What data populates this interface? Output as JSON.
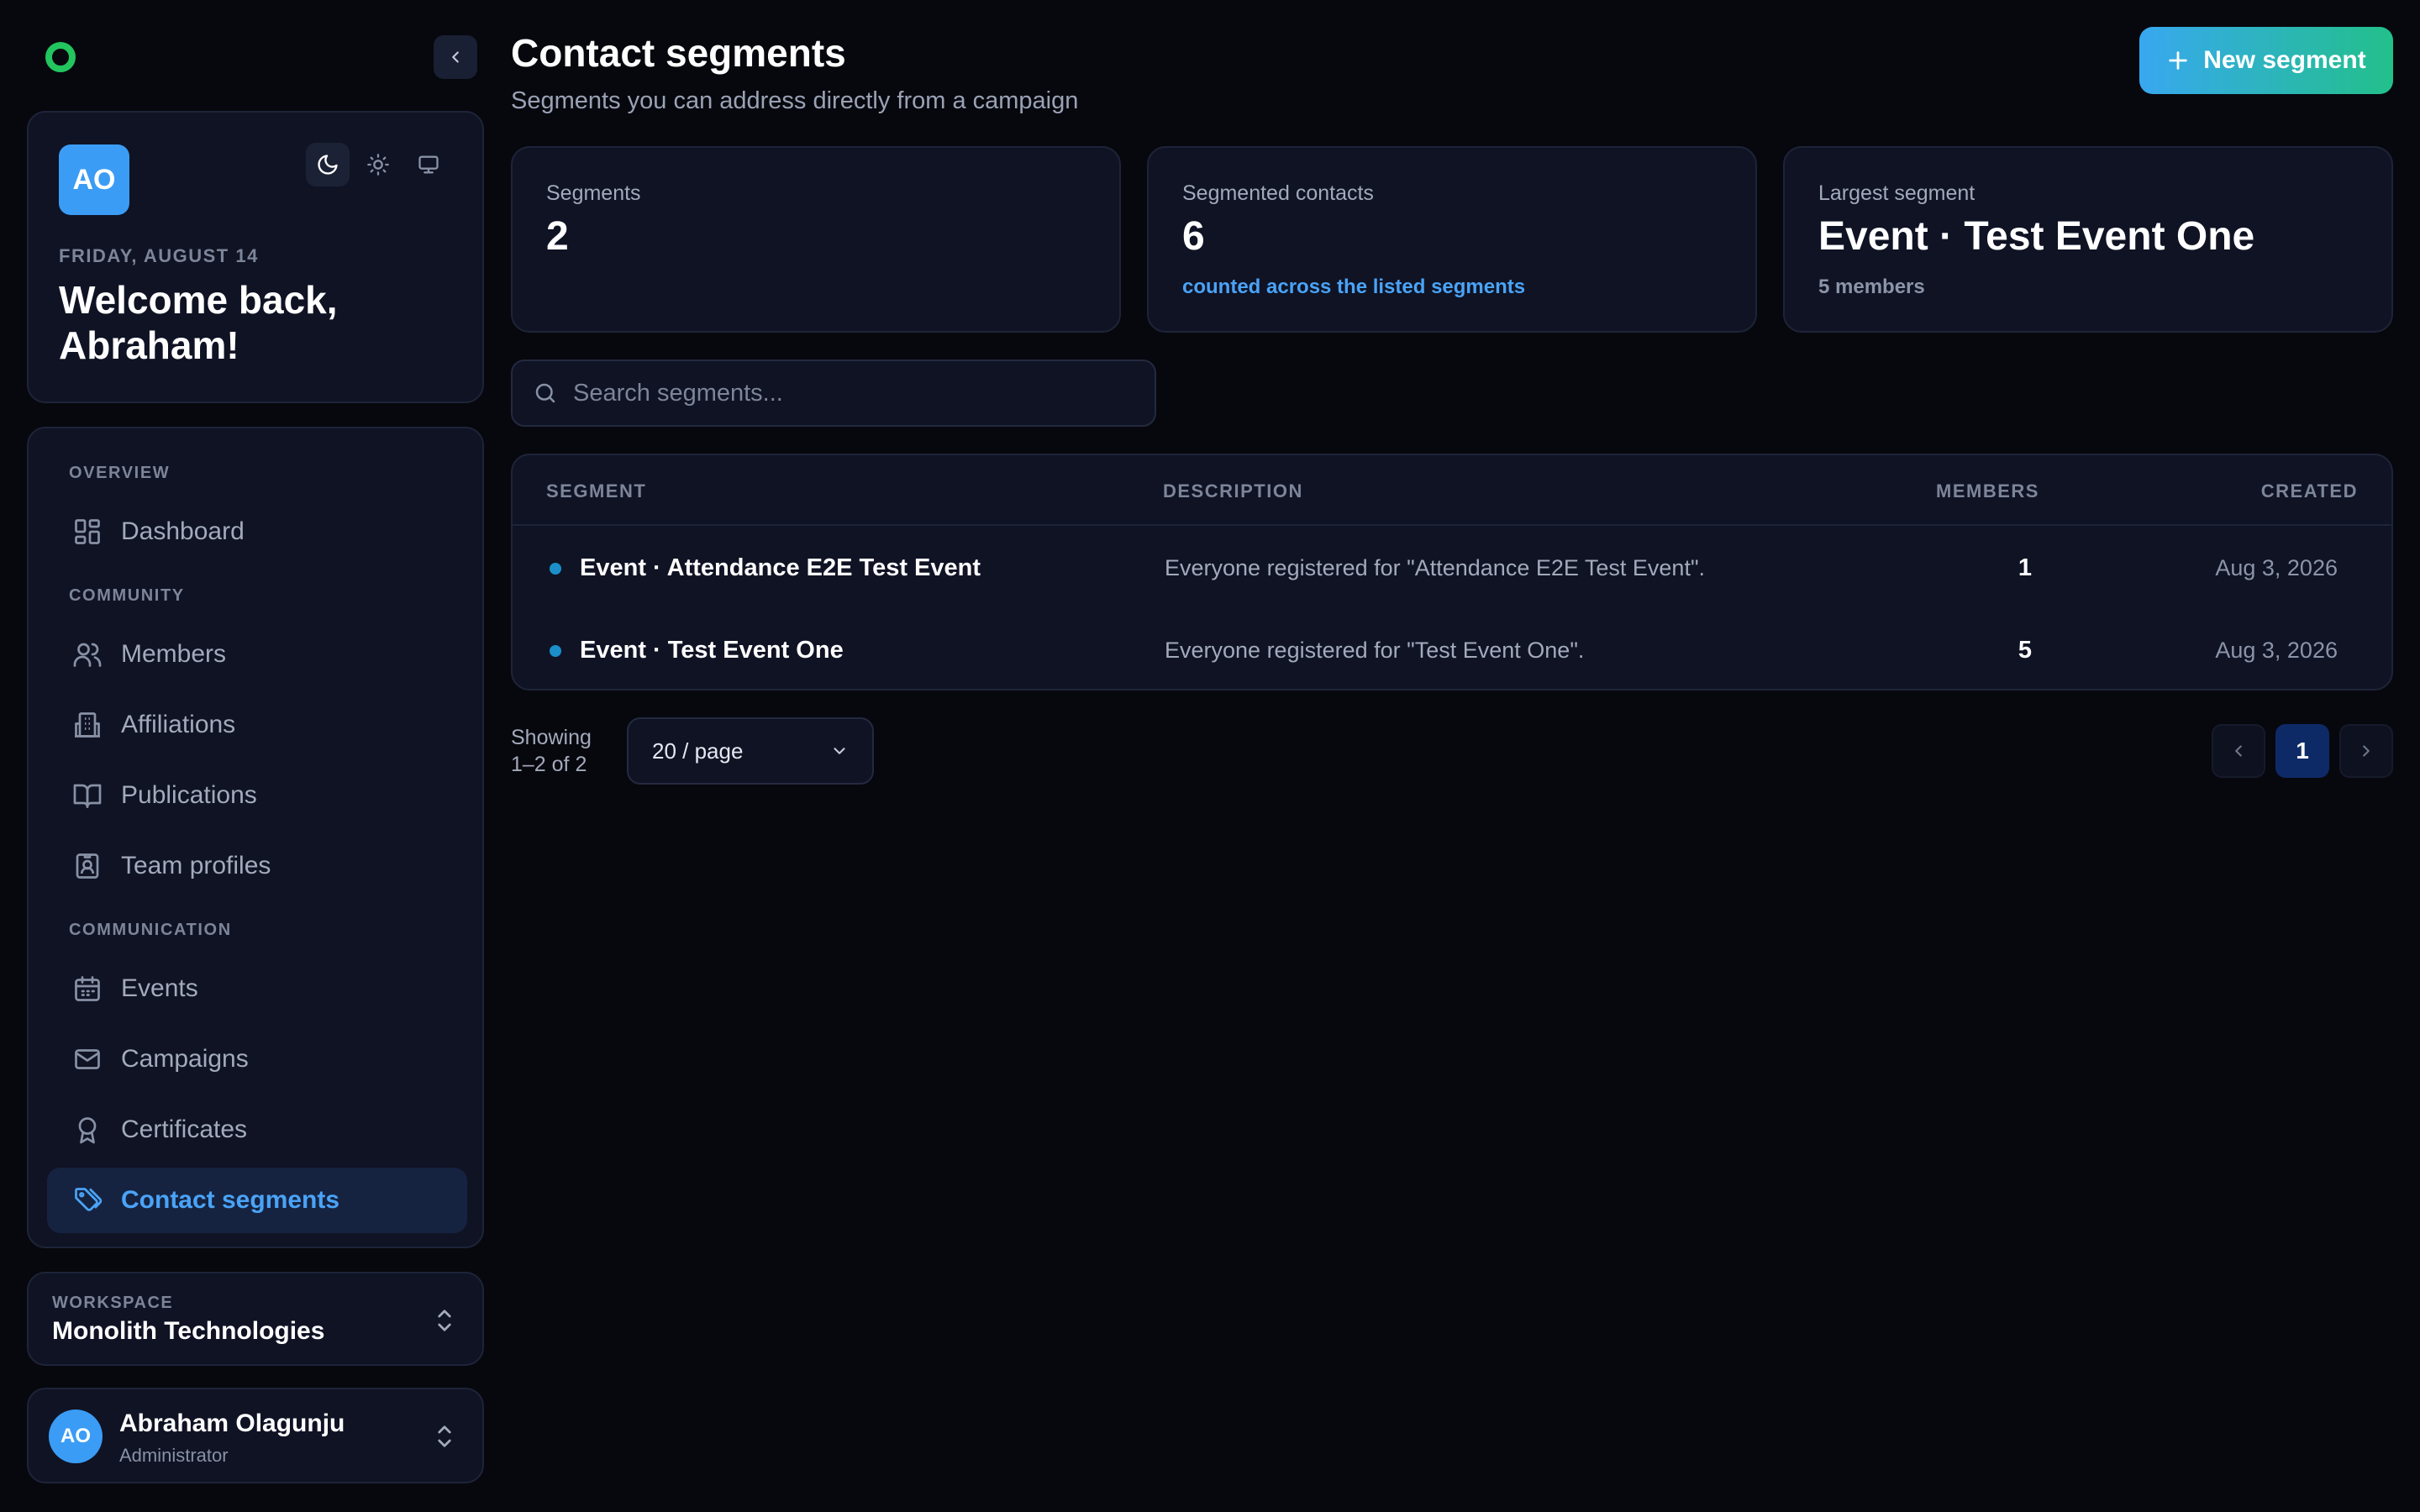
{
  "sidebar": {
    "welcome": {
      "avatar_initials": "AO",
      "date": "FRIDAY, AUGUST 14",
      "greeting": "Welcome back, Abraham!"
    },
    "sections": {
      "overview": "OVERVIEW",
      "community": "COMMUNITY",
      "communication": "COMMUNICATION"
    },
    "items": {
      "dashboard": "Dashboard",
      "members": "Members",
      "affiliations": "Affiliations",
      "publications": "Publications",
      "team_profiles": "Team profiles",
      "events": "Events",
      "campaigns": "Campaigns",
      "certificates": "Certificates",
      "contact_segments": "Contact segments"
    },
    "workspace": {
      "label": "WORKSPACE",
      "name": "Monolith Technologies"
    },
    "user": {
      "initials": "AO",
      "name": "Abraham Olagunju",
      "role": "Administrator"
    }
  },
  "header": {
    "title": "Contact segments",
    "subtitle": "Segments you can address directly from a campaign",
    "new_button": "New segment"
  },
  "stats": [
    {
      "label": "Segments",
      "value": "2",
      "note": ""
    },
    {
      "label": "Segmented contacts",
      "value": "6",
      "note": "counted across the listed segments"
    },
    {
      "label": "Largest segment",
      "value": "Event · Test Event One",
      "note": "5 members"
    }
  ],
  "search": {
    "placeholder": "Search segments..."
  },
  "table": {
    "columns": [
      "SEGMENT",
      "DESCRIPTION",
      "MEMBERS",
      "CREATED"
    ],
    "rows": [
      {
        "segment": "Event · Attendance E2E Test Event",
        "description": "Everyone registered for \"Attendance E2E Test Event\".",
        "members": "1",
        "created": "Aug 3, 2026"
      },
      {
        "segment": "Event · Test Event One",
        "description": "Everyone registered for \"Test Event One\".",
        "members": "5",
        "created": "Aug 3, 2026"
      }
    ]
  },
  "pagination": {
    "showing_line1": "Showing",
    "showing_line2": "1–2 of 2",
    "per_page": "20 / page",
    "current_page": "1"
  },
  "colors": {
    "accent": "#4aa3f7",
    "success": "#22c55e",
    "background": "#07080e",
    "card": "#0f1324"
  }
}
